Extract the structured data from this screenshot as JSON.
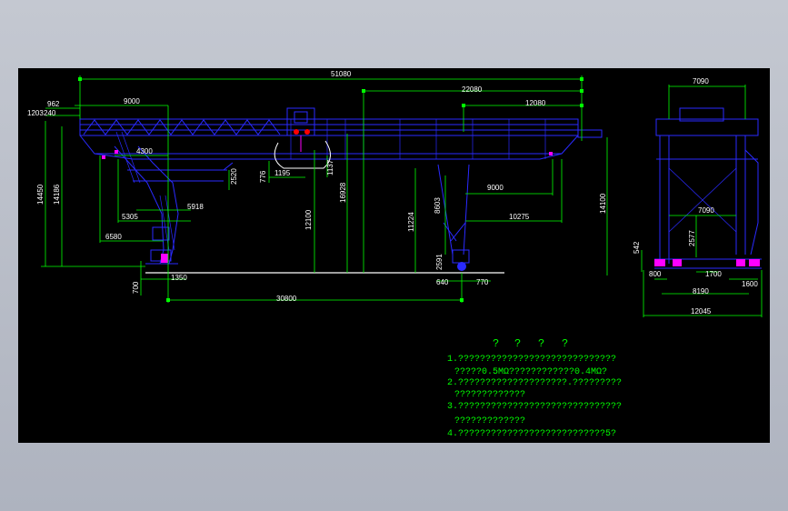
{
  "drawing": {
    "background_color": "#000000",
    "viewer_color": "#b9bec8",
    "colors": {
      "structure": "#2a2aff",
      "dimension": "#00ff00",
      "text": "#ffffff",
      "accent": "#ff00ff",
      "ground": "#ffffff"
    },
    "main_view_dimensions": {
      "overall_length": "51080",
      "left_overhang_top": "962",
      "left_small": "1203",
      "left_small_2": "240",
      "left_span": "9000",
      "right_span_total": "22080",
      "right_span_sub": "12080",
      "trolley_offset": "4300",
      "height_left": "14450",
      "height_left_inner": "14186",
      "dim_2520": "2520",
      "dim_776": "776",
      "dim_1195": "1195",
      "dim_1137": "1137",
      "dim_12100": "12100",
      "dim_16928": "16928",
      "dim_11224": "11224",
      "dim_8603": "8603",
      "dim_2591": "2591",
      "dim_9000_right": "9000",
      "dim_14100": "14100",
      "dim_10275": "10275",
      "dim_5305": "5305",
      "dim_5918": "5918",
      "dim_6580": "6580",
      "dim_700": "700",
      "dim_1350": "1350",
      "dim_640": "640",
      "dim_770": "770",
      "track_gauge": "30800"
    },
    "side_view_dimensions": {
      "top_width": "7090",
      "inner_width": "7090",
      "dim_2577": "2577",
      "dim_542": "542",
      "dim_800": "800",
      "dim_1700": "1700",
      "dim_1600": "1600",
      "dim_8190": "8190",
      "overall_width": "12045"
    },
    "notes": {
      "header_marks": [
        "?",
        "?",
        "?",
        "?"
      ],
      "lines": [
        "1.?????????????????????????????",
        "?????0.5MΩ????????????0.4MΩ?",
        "2.????????????????????.?????????",
        "?????????????",
        "3.??????????????????????????????",
        "?????????????",
        "4.???????????????????????????5?"
      ]
    }
  }
}
